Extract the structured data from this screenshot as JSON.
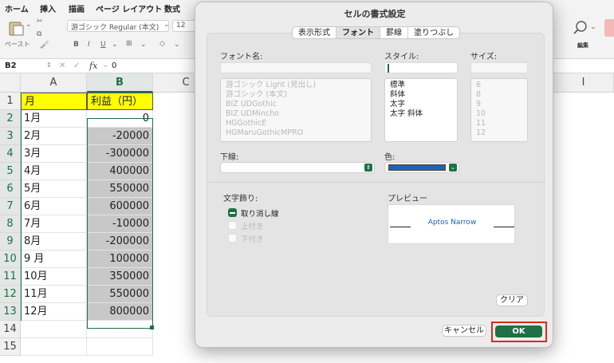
{
  "ribbon": {
    "tabs": [
      "ホーム",
      "挿入",
      "描画",
      "ページ レイアウト",
      "数式"
    ],
    "paste_label": "ペースト",
    "font_name": "游ゴシック Regular (本文)",
    "font_size": "12",
    "editing_label": "編集"
  },
  "formula_bar": {
    "name_box": "B2",
    "fx": "fx",
    "value": "0"
  },
  "sheet": {
    "columns": [
      "A",
      "B",
      "C",
      "I"
    ],
    "rows": [
      "1",
      "2",
      "3",
      "4",
      "5",
      "6",
      "7",
      "8",
      "9",
      "10",
      "11",
      "12",
      "13",
      "14",
      "15"
    ],
    "header_a": "月",
    "header_b": "利益（円）",
    "data": [
      {
        "month": "1月",
        "profit": "0"
      },
      {
        "month": "2月",
        "profit": "-20000"
      },
      {
        "month": "3月",
        "profit": "-300000"
      },
      {
        "month": "4月",
        "profit": "400000"
      },
      {
        "month": "5月",
        "profit": "550000"
      },
      {
        "month": "6月",
        "profit": "600000"
      },
      {
        "month": "7月",
        "profit": "-10000"
      },
      {
        "month": "8月",
        "profit": "-200000"
      },
      {
        "month": "9 月",
        "profit": "100000"
      },
      {
        "month": "10月",
        "profit": "350000"
      },
      {
        "month": "11月",
        "profit": "550000"
      },
      {
        "month": "12月",
        "profit": "800000"
      }
    ],
    "accent_color": "#1e7145",
    "header_fill": "#ffff00",
    "selection_fill": "#c8c8c8"
  },
  "dialog": {
    "title": "セルの書式設定",
    "tabs": [
      "表示形式",
      "フォント",
      "罫線",
      "塗りつぶし"
    ],
    "active_tab": "フォント",
    "font_name_label": "フォント名:",
    "style_label": "スタイル:",
    "size_label": "サイズ:",
    "font_list": [
      "游ゴシック Light (見出し)",
      "游ゴシック (本文)",
      "BIZ UDGothic",
      "BIZ UDMincho",
      "HGGothicE",
      "HGMaruGothicMPRO"
    ],
    "style_list": [
      "標準",
      "斜体",
      "太字",
      "太字 斜体"
    ],
    "size_list": [
      "6",
      "8",
      "9",
      "10",
      "11",
      "12"
    ],
    "underline_label": "下線:",
    "color_label": "色:",
    "font_color": "#1a64b8",
    "effects_label": "文字飾り:",
    "strikethrough_label": "取り消し線",
    "superscript_label": "上付き",
    "subscript_label": "下付き",
    "preview_label": "プレビュー",
    "preview_text": "Aptos Narrow",
    "clear_button": "クリア",
    "cancel_button": "キャンセル",
    "ok_button": "OK"
  }
}
